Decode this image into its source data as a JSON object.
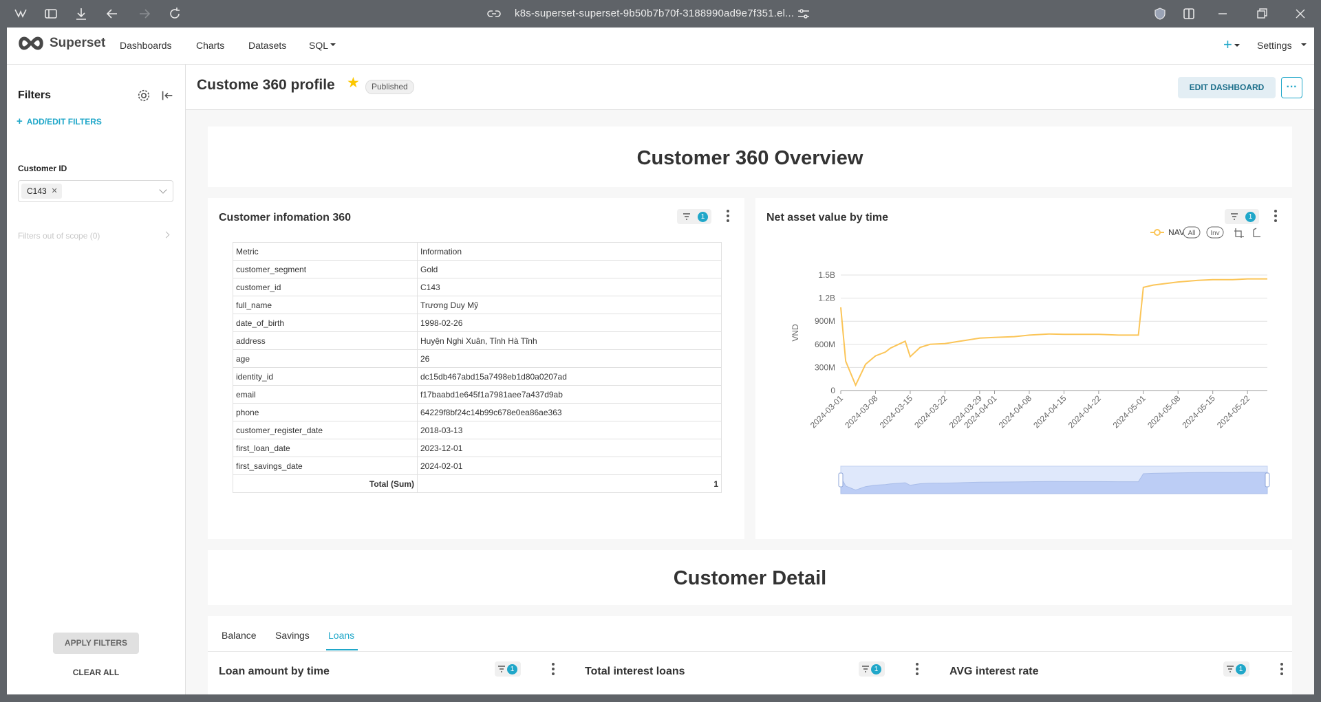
{
  "browser": {
    "url": "k8s-superset-superset-9b50b7b70f-3188990ad9e7f351.el..."
  },
  "nav": {
    "brand": "Superset",
    "links": [
      "Dashboards",
      "Charts",
      "Datasets",
      "SQL"
    ],
    "settings": "Settings"
  },
  "sidebar": {
    "title": "Filters",
    "add_edit": "ADD/EDIT FILTERS",
    "filter_label": "Customer ID",
    "filter_value": "C143",
    "out_of_scope": "Filters out of scope (0)",
    "apply": "APPLY FILTERS",
    "clear": "CLEAR ALL"
  },
  "header": {
    "title": "Custome 360 profile",
    "status": "Published",
    "edit_button": "EDIT DASHBOARD",
    "more": "···"
  },
  "overview": {
    "title": "Customer 360 Overview"
  },
  "info_card": {
    "title": "Customer infomation 360",
    "filter_count": "1",
    "columns": [
      "Metric",
      "Information"
    ],
    "rows": [
      [
        "customer_segment",
        "Gold"
      ],
      [
        "customer_id",
        "C143"
      ],
      [
        "full_name",
        "Trương Duy Mỹ"
      ],
      [
        "date_of_birth",
        "1998-02-26"
      ],
      [
        "address",
        "Huyện Nghi Xuân, Tỉnh Hà Tĩnh"
      ],
      [
        "age",
        "26"
      ],
      [
        "identity_id",
        "dc15db467abd15a7498eb1d80a0207ad"
      ],
      [
        "email",
        "f17baabd1e645f1a7981aee7a437d9ab"
      ],
      [
        "phone",
        "64229f8bf24c14b99c678e0ea86ae363"
      ],
      [
        "customer_register_date",
        "2018-03-13"
      ],
      [
        "first_loan_date",
        "2023-12-01"
      ],
      [
        "first_savings_date",
        "2024-02-01"
      ]
    ],
    "total_label": "Total (Sum)",
    "total_value": "1"
  },
  "nav_card": {
    "title": "Net asset value by time",
    "filter_count": "1",
    "legend": "NAV",
    "btn_all": "All",
    "btn_inv": "Inv"
  },
  "chart_data": {
    "type": "line",
    "title": "Net asset value by time",
    "ylabel": "VND",
    "xlabel": "",
    "ylim": [
      0,
      1500000000
    ],
    "y_ticks": [
      "0",
      "300M",
      "600M",
      "900M",
      "1.2B",
      "1.5B"
    ],
    "x_ticks": [
      "2024-03-01",
      "2024-03-08",
      "2024-03-15",
      "2024-03-22",
      "2024-03-29",
      "2024-04-01",
      "2024-04-08",
      "2024-04-15",
      "2024-04-22",
      "2024-05-01",
      "2024-05-08",
      "2024-05-15",
      "2024-05-22"
    ],
    "series": [
      {
        "name": "NAV",
        "color": "#fbc558",
        "points": [
          [
            "2024-03-01",
            1080000000
          ],
          [
            "2024-03-02",
            380000000
          ],
          [
            "2024-03-04",
            70000000
          ],
          [
            "2024-03-06",
            340000000
          ],
          [
            "2024-03-08",
            450000000
          ],
          [
            "2024-03-10",
            500000000
          ],
          [
            "2024-03-11",
            550000000
          ],
          [
            "2024-03-14",
            640000000
          ],
          [
            "2024-03-15",
            440000000
          ],
          [
            "2024-03-17",
            560000000
          ],
          [
            "2024-03-19",
            600000000
          ],
          [
            "2024-03-22",
            610000000
          ],
          [
            "2024-03-25",
            640000000
          ],
          [
            "2024-03-29",
            680000000
          ],
          [
            "2024-04-01",
            690000000
          ],
          [
            "2024-04-05",
            700000000
          ],
          [
            "2024-04-08",
            720000000
          ],
          [
            "2024-04-12",
            735000000
          ],
          [
            "2024-04-15",
            730000000
          ],
          [
            "2024-04-19",
            730000000
          ],
          [
            "2024-04-22",
            730000000
          ],
          [
            "2024-04-26",
            720000000
          ],
          [
            "2024-04-30",
            720000000
          ],
          [
            "2024-05-01",
            1340000000
          ],
          [
            "2024-05-03",
            1370000000
          ],
          [
            "2024-05-08",
            1410000000
          ],
          [
            "2024-05-12",
            1430000000
          ],
          [
            "2024-05-15",
            1440000000
          ],
          [
            "2024-05-19",
            1440000000
          ],
          [
            "2024-05-22",
            1450000000
          ],
          [
            "2024-05-26",
            1450000000
          ]
        ]
      }
    ],
    "grid": true,
    "legend_position": "top-right"
  },
  "detail": {
    "title": "Customer Detail"
  },
  "tabs": [
    "Balance",
    "Savings",
    "Loans"
  ],
  "active_tab": "Loans",
  "bottom_charts": [
    {
      "title": "Loan amount by time",
      "filter_count": "1"
    },
    {
      "title": "Total interest loans",
      "filter_count": "1"
    },
    {
      "title": "AVG interest rate",
      "filter_count": "1"
    }
  ],
  "colors": {
    "accent": "#20a7c9",
    "line": "#fbc558",
    "star": "#fcc700"
  }
}
